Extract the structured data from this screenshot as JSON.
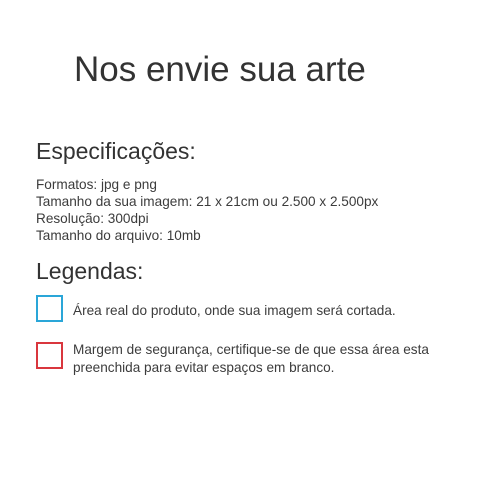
{
  "title": "Nos envie sua arte",
  "specs": {
    "heading": "Especificações:",
    "lines": [
      "Formatos: jpg e png",
      "Tamanho da sua imagem: 21 x 21cm ou 2.500 x 2.500px",
      "Resolução: 300dpi",
      "Tamanho do arquivo: 10mb"
    ]
  },
  "legend": {
    "heading": "Legendas:",
    "items": [
      {
        "color": "#2aa6d8",
        "text": "Área real do produto, onde sua imagem será cortada."
      },
      {
        "color": "#d9363e",
        "text": "Margem de segurança, certifique-se de que essa área esta preenchida para evitar espaços em branco."
      }
    ]
  }
}
